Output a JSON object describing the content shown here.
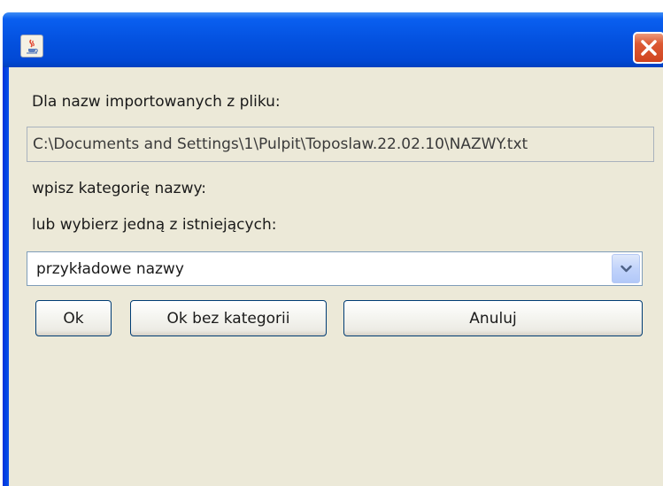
{
  "dialog": {
    "title": "",
    "import_label": "Dla nazw importowanych z pliku:",
    "file_path": "C:\\Documents and Settings\\1\\Pulpit\\Toposlaw.22.02.10\\NAZWY.txt",
    "category_label": "wpisz kategorię nazwy:",
    "choose_label": "lub wybierz jedną z istniejących:",
    "category_select": {
      "selected": "przykładowe nazwy"
    },
    "buttons": {
      "ok": "Ok",
      "ok_no_category": "Ok bez kategorii",
      "cancel": "Anuluj"
    }
  },
  "icons": {
    "app": "java-cup-icon",
    "close": "close-icon",
    "dropdown": "chevron-down-icon"
  },
  "colors": {
    "titlebar": "#0452e0",
    "close_button": "#d9532f",
    "client_background": "#ece9d8",
    "button_border": "#003c74"
  }
}
